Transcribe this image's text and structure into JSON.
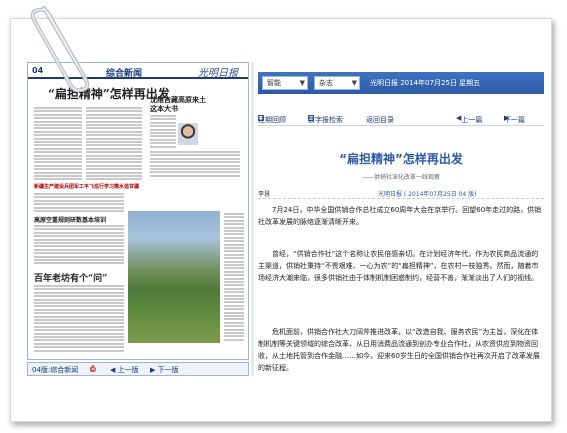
{
  "newspaper_page": {
    "page_number": "04",
    "section": "综合新闻",
    "logo": "光明日报",
    "headlines": [
      "“扁担精神”怎样再出发",
      "沈维吉藏高原来土这本大书",
      "新疆生产建设兵团军工平飞巡行学习需水造甘疆",
      "高原空重规则研数基本培训",
      "百年老坊有个“问”"
    ]
  },
  "page_footer": {
    "page_label": "04版:综合新闻",
    "prev_label": "上一版",
    "next_label": "下一版"
  },
  "toolbar": {
    "select_edition": "智能",
    "select_paper": "杂志",
    "date_text": "光明日报  2014年07月25日  星期五"
  },
  "navbar": {
    "home_label": "往期回顾",
    "catalog_label": "数字报检索",
    "back_label": "返回目录",
    "prev_label": "上一篇",
    "next_label": "下一篇"
  },
  "article": {
    "title": "“扁担精神”怎样再出发",
    "subtitle": "——供销社深化改革一线观察",
    "author": "李慧",
    "source": "光明日报  (  2014年07月25日  04  版)",
    "paragraphs": [
      "7月24日，中华全国供销合作总社成立60周年大会在京举行。回望60年走过的路，供销社改革发展的脉络逐渐清晰开来。",
      "曾经，“供销合作社”这个名称让农民倍感亲切。在计划经济年代，作为农民商品流通的主渠道，供销社秉持“不畏艰难、一心为农”的“扁担精神”，在农村一枝独秀。然而，随着市场经济大潮来临，很多供销社由于体制机制困惑制约，经营不善，渐渐淡出了人们的视线。",
      "危机面前，供销合作社大刀阔斧推进改革，以“改造自我、服务农民”为主旨，深化在体制机制等关键领域的综合改革，从日用消费品流通到创办专业合作社，从农资供应到物资回收，从土地托管到合作金融……如今，迎来60岁生日的全国供销合作社再次开启了改革发展的新征程。"
    ]
  },
  "colors": {
    "accent": "#2d5aa6",
    "toolbar": "#3f73c2",
    "headline_dark": "#1a3a7a"
  }
}
